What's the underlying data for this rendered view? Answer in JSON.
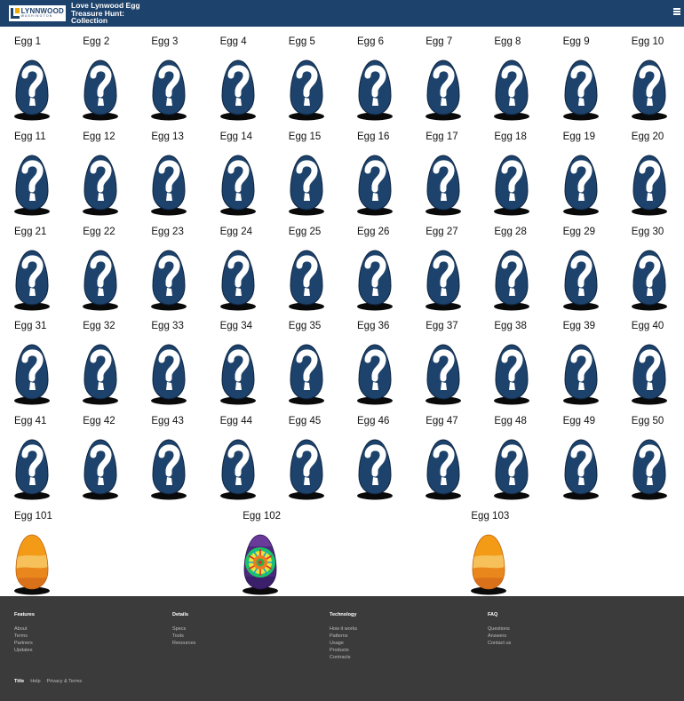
{
  "header": {
    "logo_big": "LYNNWOOD",
    "logo_small": "WASHINGTON",
    "title": "Love Lynwood Egg Treasure Hunt: Collection",
    "menu_icon": "hamburger-menu-icon"
  },
  "mystery_eggs": [
    "Egg 1",
    "Egg 2",
    "Egg 3",
    "Egg 4",
    "Egg 5",
    "Egg 6",
    "Egg 7",
    "Egg 8",
    "Egg 9",
    "Egg 10",
    "Egg 11",
    "Egg 12",
    "Egg 13",
    "Egg 14",
    "Egg 15",
    "Egg 16",
    "Egg 17",
    "Egg 18",
    "Egg 19",
    "Egg 20",
    "Egg 21",
    "Egg 22",
    "Egg 23",
    "Egg 24",
    "Egg 25",
    "Egg 26",
    "Egg 27",
    "Egg 28",
    "Egg 29",
    "Egg 30",
    "Egg 31",
    "Egg 32",
    "Egg 33",
    "Egg 34",
    "Egg 35",
    "Egg 36",
    "Egg 37",
    "Egg 38",
    "Egg 39",
    "Egg 40",
    "Egg 41",
    "Egg 42",
    "Egg 43",
    "Egg 44",
    "Egg 45",
    "Egg 46",
    "Egg 47",
    "Egg 48",
    "Egg 49",
    "Egg 50"
  ],
  "found_eggs": [
    {
      "label": "Egg 101",
      "style": "orange-stripes"
    },
    {
      "label": "Egg 102",
      "style": "green-mandala"
    },
    {
      "label": "Egg 103",
      "style": "orange-stripes"
    }
  ],
  "colors": {
    "header_bg": "#1d426b",
    "egg_blue": "#1d426b",
    "footer_bg": "#3b3b3b",
    "accent_yellow": "#f2a900"
  },
  "footer": {
    "columns": [
      {
        "heading": "Features",
        "links": [
          "About",
          "Terms",
          "Partners",
          "Updates"
        ]
      },
      {
        "heading": "Details",
        "links": [
          "Specs",
          "Tools",
          "Resources"
        ]
      },
      {
        "heading": "Technology",
        "links": [
          "How it works",
          "Patterns",
          "Usage",
          "Products",
          "Contracts"
        ]
      },
      {
        "heading": "FAQ",
        "links": [
          "Questions",
          "Answers",
          "Contact us"
        ]
      }
    ],
    "bottom": {
      "brand": "Title",
      "links": [
        "Help",
        "Privacy & Terms"
      ]
    }
  }
}
